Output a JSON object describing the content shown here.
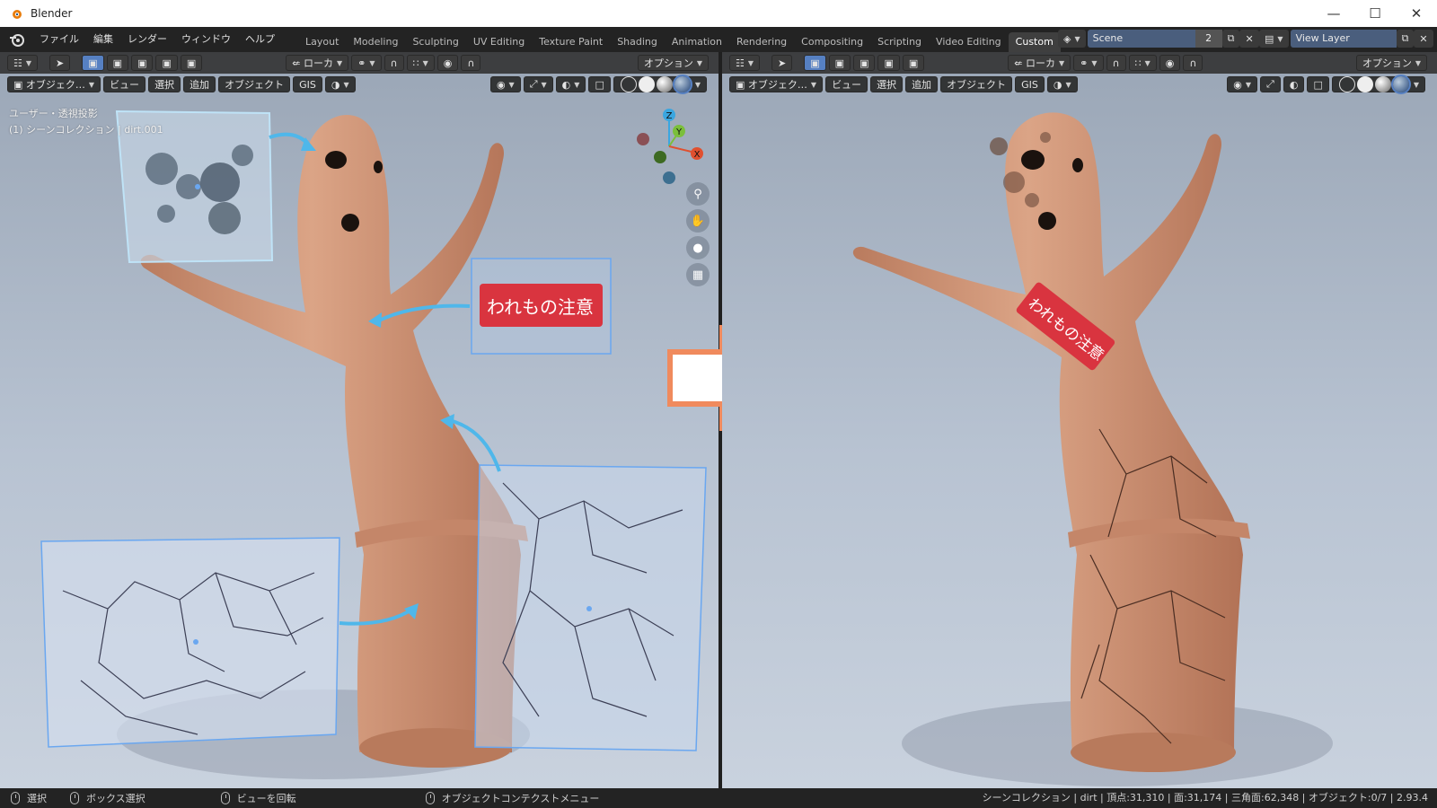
{
  "window": {
    "title": "Blender",
    "minimize_icon": "minimize-icon",
    "maximize_icon": "maximize-icon",
    "close_icon": "close-icon"
  },
  "menu": [
    "ファイル",
    "編集",
    "レンダー",
    "ウィンドウ",
    "ヘルプ"
  ],
  "workspaces": {
    "tabs": [
      "Layout",
      "Modeling",
      "Sculpting",
      "UV Editing",
      "Texture Paint",
      "Shading",
      "Animation",
      "Rendering",
      "Compositing",
      "Scripting",
      "Video Editing",
      "Custom"
    ],
    "active": "Custom"
  },
  "scene": {
    "name": "Scene",
    "users": "2"
  },
  "view_layer": {
    "name": "View Layer"
  },
  "viewport_header": {
    "transform_orientation": "ローカ",
    "options_label": "オプション",
    "mode_label": "オブジェク…",
    "menus": [
      "ビュー",
      "選択",
      "追加",
      "オブジェクト",
      "GIS"
    ]
  },
  "viewport_left": {
    "info_line1": "ユーザー・透視投影",
    "info_line2": "(1) シーンコレクション | dirt.001"
  },
  "gizmo": {
    "z": "Z",
    "y": "Y",
    "x": "X"
  },
  "decal_text": "われもの注意",
  "statusbar": {
    "select": "選択",
    "box_select": "ボックス選択",
    "rotate_view": "ビューを回転",
    "context_menu": "オブジェクトコンテクストメニュー",
    "stats": "シーンコレクション | dirt | 頂点:31,310 | 面:31,174 | 三角面:62,348 | オブジェクト:0/7 | 2.93.4"
  },
  "colors": {
    "accent": "#5680c2",
    "clay": "#d49a7a",
    "arrow_orange": "#f08a5d",
    "decal_red": "#d9343f",
    "selection_blue": "#6aa7f0"
  }
}
